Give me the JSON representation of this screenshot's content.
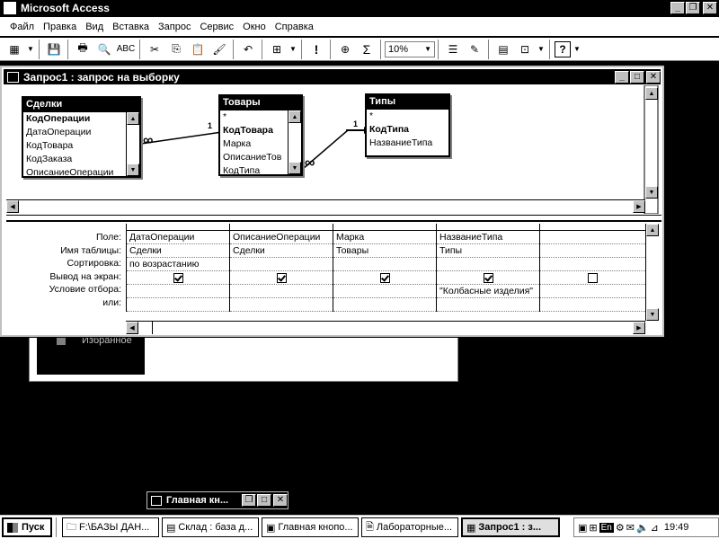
{
  "app": {
    "title": "Microsoft Access"
  },
  "menu": [
    "Файл",
    "Правка",
    "Вид",
    "Вставка",
    "Запрос",
    "Сервис",
    "Окно",
    "Справка"
  ],
  "toolbar": {
    "zoom": "10%"
  },
  "query_window": {
    "title": "Запрос1 : запрос на выборку",
    "tables": [
      {
        "name": "Сделки",
        "fields": [
          "КодОперации",
          "ДатаОперации",
          "КодТовара",
          "КодЗаказа",
          "ОписаниеОперации"
        ]
      },
      {
        "name": "Товары",
        "fields": [
          "*",
          "КодТовара",
          "Марка",
          "ОписаниеТов",
          "КодТипа"
        ]
      },
      {
        "name": "Типы",
        "fields": [
          "*",
          "КодТипа",
          "НазваниеТипа"
        ]
      }
    ],
    "relation_one": "1",
    "relation_many": "∞",
    "row_labels": [
      "Поле:",
      "Имя таблицы:",
      "Сортировка:",
      "Вывод на экран:",
      "Условие отбора:",
      "или:"
    ],
    "columns": [
      {
        "field": "ДатаОперации",
        "table": "Сделки",
        "sort": "по возрастанию",
        "show": true,
        "criteria": ""
      },
      {
        "field": "ОписаниеОперации",
        "table": "Сделки",
        "sort": "",
        "show": true,
        "criteria": ""
      },
      {
        "field": "Марка",
        "table": "Товары",
        "sort": "",
        "show": true,
        "criteria": ""
      },
      {
        "field": "НазваниеТипа",
        "table": "Типы",
        "sort": "",
        "show": true,
        "criteria": "\"Колбасные изделия\""
      },
      {
        "field": "",
        "table": "",
        "sort": "",
        "show": false,
        "criteria": ""
      }
    ]
  },
  "background": {
    "favorites_label": "Избранное"
  },
  "mini_window": {
    "title": "Главная кн..."
  },
  "taskbar": {
    "start": "Пуск",
    "tasks": [
      "F:\\БАЗЫ ДАН...",
      "Склад : база д...",
      "Главная кнопо...",
      "Лабораторные...",
      "Запрос1 : з..."
    ],
    "lang": "En",
    "time": "19:49"
  }
}
